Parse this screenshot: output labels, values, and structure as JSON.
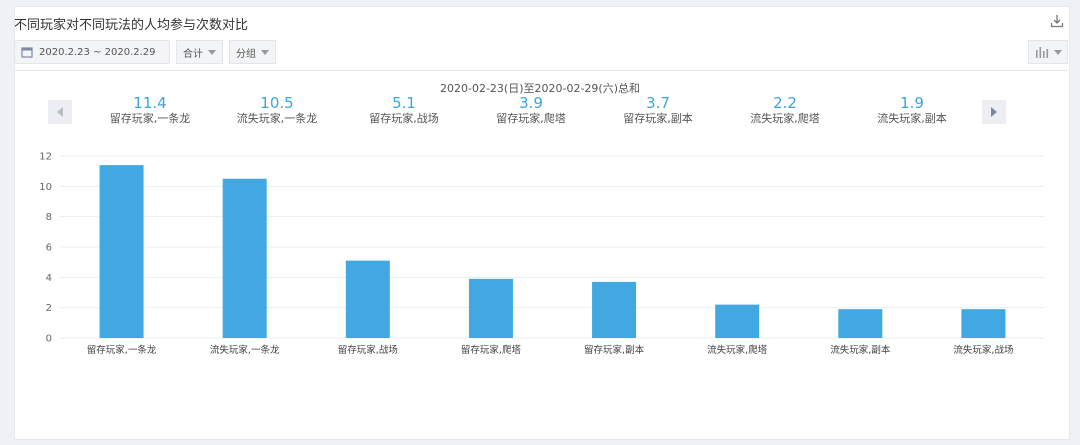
{
  "header": {
    "title": "不同玩家对不同玩法的人均参与次数对比",
    "date_range": "2020.2.23 ~ 2020.2.29",
    "aggregate_label": "合计",
    "group_label": "分组"
  },
  "icons": {
    "export": "download-icon",
    "calendar": "calendar-icon",
    "chart_type": "bar-chart-icon"
  },
  "summary": {
    "heading": "2020-02-23(日)至2020-02-29(六)总和",
    "items": [
      {
        "value": "11.4",
        "label": "留存玩家,一条龙"
      },
      {
        "value": "10.5",
        "label": "流失玩家,一条龙"
      },
      {
        "value": "5.1",
        "label": "留存玩家,战场"
      },
      {
        "value": "3.9",
        "label": "留存玩家,爬塔"
      },
      {
        "value": "3.7",
        "label": "留存玩家,副本"
      },
      {
        "value": "2.2",
        "label": "流失玩家,爬塔"
      },
      {
        "value": "1.9",
        "label": "流失玩家,副本"
      }
    ]
  },
  "colors": {
    "bar": "#42a8e2",
    "accent": "#3ba6e0",
    "grid": "#ebedf0"
  },
  "chart_data": {
    "type": "bar",
    "categories": [
      "留存玩家,一条龙",
      "流失玩家,一条龙",
      "留存玩家,战场",
      "留存玩家,爬塔",
      "留存玩家,副本",
      "流失玩家,爬塔",
      "流失玩家,副本",
      "流失玩家,战场"
    ],
    "values": [
      11.4,
      10.5,
      5.1,
      3.9,
      3.7,
      2.2,
      1.9,
      1.9
    ],
    "ylim": [
      0,
      12
    ],
    "yticks": [
      0,
      2,
      4,
      6,
      8,
      10,
      12
    ],
    "grid": true,
    "legend": "none"
  }
}
